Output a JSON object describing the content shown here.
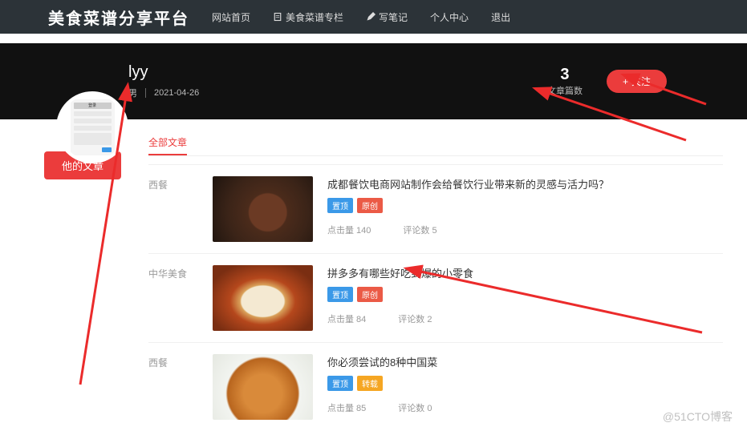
{
  "site": {
    "title": "美食菜谱分享平台"
  },
  "nav": {
    "home": "网站首页",
    "column": "美食菜谱专栏",
    "write_note": "写笔记",
    "user_center": "个人中心",
    "logout": "退出"
  },
  "profile": {
    "username": "lyy",
    "gender": "男",
    "date": "2021-04-26",
    "stat_count": "3",
    "stat_label": "文章篇数",
    "follow_label": "关注"
  },
  "sidebar": {
    "his_articles": "他的文章"
  },
  "tabs": {
    "all": "全部文章"
  },
  "tag_labels": {
    "top": "置顶",
    "original": "原创",
    "transfer": "转载"
  },
  "meta_labels": {
    "views": "点击量",
    "comments": "评论数"
  },
  "articles": [
    {
      "category": "西餐",
      "title": "成都餐饮电商网站制作会给餐饮行业带来新的灵感与活力吗？",
      "tags": [
        "top",
        "original"
      ],
      "views": "140",
      "comments": "5",
      "thumb": "braised"
    },
    {
      "category": "中华美食",
      "title": "拼多多有哪些好吃到爆的小零食",
      "tags": [
        "top",
        "original"
      ],
      "views": "84",
      "comments": "2",
      "thumb": "porridge"
    },
    {
      "category": "西餐",
      "title": "你必须尝试的8种中国菜",
      "tags": [
        "top",
        "transfer"
      ],
      "views": "85",
      "comments": "0",
      "thumb": "crab"
    }
  ],
  "watermark": "@51CTO博客"
}
